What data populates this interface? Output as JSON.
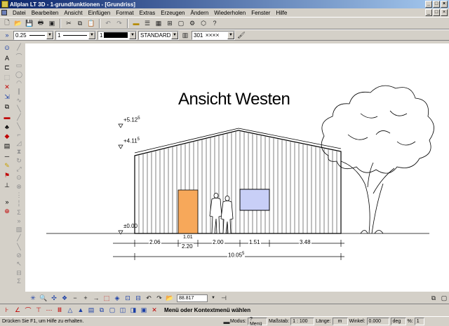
{
  "window": {
    "title": "Allplan LT 3D - 1-grundfunktionen - [Grundriss]",
    "min": "_",
    "max": "□",
    "close": "×"
  },
  "menu": [
    "Datei",
    "Bearbeiten",
    "Ansicht",
    "Einfügen",
    "Format",
    "Extras",
    "Erzeugen",
    "Ändern",
    "Wiederholen",
    "Fenster",
    "Hilfe"
  ],
  "toolbar2": {
    "pen_thickness": "0.25",
    "line_type": "1",
    "color": "1",
    "layer": "STANDARD",
    "hatch": "301"
  },
  "drawing": {
    "title": "Ansicht Westen",
    "elev_top": "+5.12",
    "elev_top_sup": "5",
    "elev_eave": "+4.11",
    "elev_eave_sup": "5",
    "elev_ground": "±0.00",
    "dims": [
      "2.06",
      "1.01",
      "2.20",
      "2.00",
      "1.51",
      "3.48"
    ],
    "dim_total": "10.05",
    "dim_total_sup": "5"
  },
  "viewbar": {
    "zoom_value": "88.817"
  },
  "cmdbar": {
    "prompt": "Menü oder Kontextmenü wählen"
  },
  "status": {
    "help": "Drücken Sie F1, um Hilfe zu erhalten.",
    "mode_label": "Modus:",
    "mode_value": "? Menü",
    "scale_label": "Maßstab:",
    "scale_value": "1 : 100",
    "length_label": "Länge:",
    "length_value": "m",
    "angle_label": "Winkel:",
    "angle_value": "0.000",
    "angle_unit": "deg",
    "percent_label": "%:",
    "percent_value": "1"
  },
  "colors": {
    "titlebar": "#0a246a",
    "chrome": "#d4d0c8",
    "door": "#f7a85a",
    "window": "#c8cff7"
  }
}
